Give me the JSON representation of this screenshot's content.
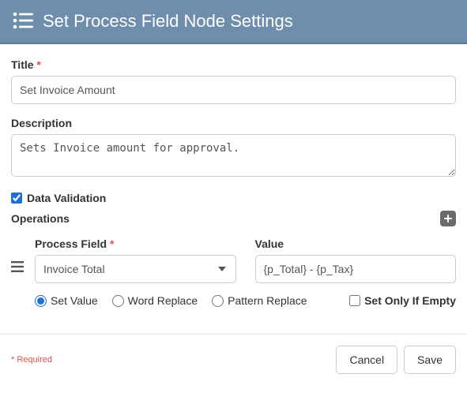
{
  "header": {
    "title": "Set Process Field Node Settings"
  },
  "form": {
    "title_label": "Title",
    "title_value": "Set Invoice Amount",
    "description_label": "Description",
    "description_value": "Sets Invoice amount for approval.",
    "data_validation_label": "Data Validation",
    "data_validation_checked": true
  },
  "operations": {
    "section_label": "Operations",
    "process_field_label": "Process Field",
    "process_field_value": "Invoice Total",
    "value_label": "Value",
    "value_value": "{p_Total} - {p_Tax}",
    "mode_options": {
      "set_value": "Set Value",
      "word_replace": "Word Replace",
      "pattern_replace": "Pattern Replace"
    },
    "set_only_if_empty_label": "Set Only If Empty"
  },
  "footer": {
    "required_note": "* Required",
    "cancel": "Cancel",
    "save": "Save"
  }
}
